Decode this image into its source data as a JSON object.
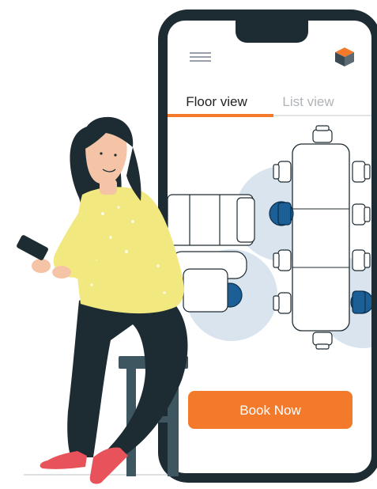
{
  "tabs": [
    {
      "label": "Floor view",
      "active": true
    },
    {
      "label": "List view",
      "active": false
    }
  ],
  "book_button": {
    "label": "Book Now"
  },
  "colors": {
    "accent": "#f37a2b",
    "phone_frame": "#1d2b32",
    "screen_bg": "#ffffff",
    "seat_highlight": "#1b5f96",
    "coverage_zone": "#d9e4ef",
    "shirt": "#f2e880",
    "shoes": "#e8535b"
  },
  "icons": {
    "menu": "hamburger-menu-icon",
    "logo": "cube-logo-icon"
  }
}
